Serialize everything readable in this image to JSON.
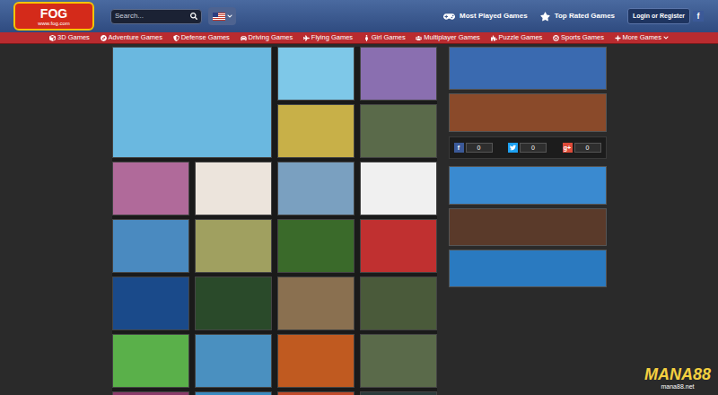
{
  "header": {
    "logo": {
      "name": "FOG",
      "url": "www.fog.com"
    },
    "search": {
      "placeholder": "Search..."
    },
    "links": [
      {
        "label": "Most Played Games"
      },
      {
        "label": "Top Rated Games"
      }
    ],
    "login": "Login or Register",
    "facebook": "f"
  },
  "nav": [
    {
      "label": "3D Games",
      "dropdown": false
    },
    {
      "label": "Adventure Games",
      "dropdown": false
    },
    {
      "label": "Defense Games",
      "dropdown": false
    },
    {
      "label": "Driving Games",
      "dropdown": false
    },
    {
      "label": "Flying Games",
      "dropdown": false
    },
    {
      "label": "Girl Games",
      "dropdown": false
    },
    {
      "label": "Multiplayer Games",
      "dropdown": false
    },
    {
      "label": "Puzzle Games",
      "dropdown": false
    },
    {
      "label": "Sports Games",
      "dropdown": false
    },
    {
      "label": "More Games",
      "dropdown": true
    }
  ],
  "games": [
    {
      "kind": "featured",
      "color": "#6ab8e0"
    },
    {
      "kind": "tile",
      "color": "#7ec8e8"
    },
    {
      "kind": "tile",
      "color": "#8a6fb0"
    },
    {
      "kind": "tile",
      "color": "#c8b048"
    },
    {
      "kind": "tile",
      "color": "#5a6a4a"
    },
    {
      "kind": "tile",
      "color": "#b06a9a"
    },
    {
      "kind": "tile",
      "color": "#ece4dc"
    },
    {
      "kind": "tile",
      "color": "#7aa0c0"
    },
    {
      "kind": "tile",
      "color": "#f0f0f0"
    },
    {
      "kind": "tile",
      "color": "#4a8ac0"
    },
    {
      "kind": "tile",
      "color": "#a0a060"
    },
    {
      "kind": "tile",
      "color": "#3a6a2a"
    },
    {
      "kind": "tile",
      "color": "#c03030"
    },
    {
      "kind": "tile",
      "color": "#1a4a8a"
    },
    {
      "kind": "tile",
      "color": "#2a4a2a"
    },
    {
      "kind": "tile",
      "color": "#8a7050"
    },
    {
      "kind": "tile",
      "color": "#4a5a3a"
    },
    {
      "kind": "tile",
      "color": "#5ab04a"
    },
    {
      "kind": "tile",
      "color": "#4a90c0"
    },
    {
      "kind": "tile",
      "color": "#c05a20"
    },
    {
      "kind": "tile",
      "color": "#5a6a4a"
    },
    {
      "kind": "tile",
      "color": "#8a3a6a"
    },
    {
      "kind": "tile",
      "color": "#3a8ac0"
    },
    {
      "kind": "tile",
      "color": "#c04a2a"
    },
    {
      "kind": "tile",
      "color": "#2a3a3a"
    }
  ],
  "sidebar": {
    "banners_top": [
      {
        "color": "#3a6ab0"
      },
      {
        "color": "#8a4a2a"
      }
    ],
    "share": [
      {
        "network": "facebook",
        "icon": "f",
        "count": "0",
        "color": "#3b5998"
      },
      {
        "network": "twitter",
        "icon": "",
        "count": "0",
        "color": "#1da1f2"
      },
      {
        "network": "google",
        "icon": "g+",
        "count": "0",
        "color": "#dd4b39"
      }
    ],
    "banners_bottom": [
      {
        "color": "#3a8ad0"
      },
      {
        "color": "#5a3a2a"
      },
      {
        "color": "#2a7ac0"
      }
    ]
  },
  "watermark": {
    "brand": "MANA88",
    "url": "mana88.net"
  }
}
